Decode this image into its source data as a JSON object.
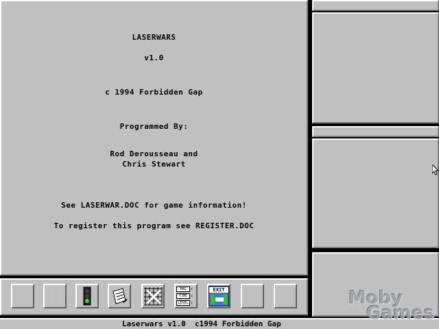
{
  "info": {
    "title": "LASERWARS",
    "version": "v1.0",
    "copyright": "c 1994 Forbidden Gap",
    "programmed_by": "Programmed By:",
    "author_line1": "Rod Derousseau and",
    "author_line2": "Chris Stewart",
    "doc_note": "See LASERWAR.DOC for game information!",
    "register_note": "To register this program see REGISTER.DOC"
  },
  "toolbar": {
    "settings_labels": [
      "MAG",
      "TIME",
      "LEVEL"
    ],
    "exit_label": "EXIT"
  },
  "status_bar": {
    "text": "Laserwars v1.0  c1994 Forbidden Gap"
  },
  "watermark": {
    "line1": "Moby",
    "line2": "Games"
  },
  "colors": {
    "panel": "#c0c0c0",
    "highlight": "#ffffff",
    "shadow": "#808080",
    "background": "#000000"
  }
}
